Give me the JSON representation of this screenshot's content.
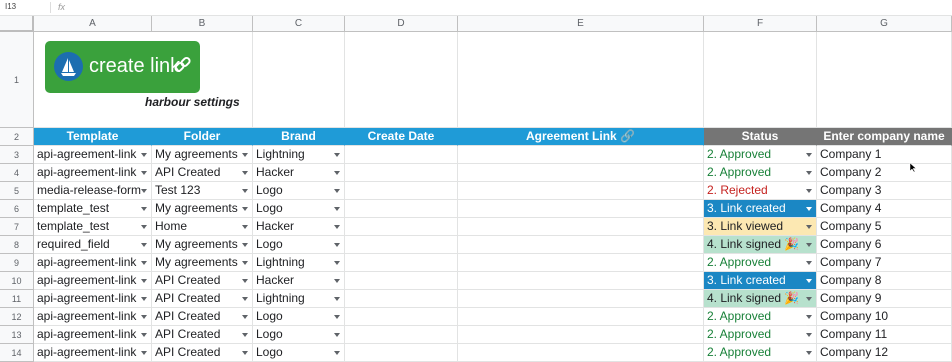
{
  "formula_bar": {
    "cell_ref": "I13",
    "fx": "fx"
  },
  "columns": [
    "A",
    "B",
    "C",
    "D",
    "E",
    "F",
    "G"
  ],
  "row_numbers": [
    "1",
    "2",
    "3",
    "4",
    "5",
    "6",
    "7",
    "8",
    "9",
    "10",
    "11",
    "12",
    "13",
    "14"
  ],
  "logo": {
    "text": "create link"
  },
  "subtitle": "harbour settings",
  "headers": {
    "template": "Template",
    "folder": "Folder",
    "brand": "Brand",
    "create_date": "Create Date",
    "agreement_link": "Agreement Link 🔗",
    "status": "Status",
    "company": "Enter company name"
  },
  "rows": [
    {
      "template": "api-agreement-link",
      "folder": "My agreements",
      "brand": "Lightning",
      "status": "2. Approved",
      "company": "Company 1"
    },
    {
      "template": "api-agreement-link",
      "folder": "API Created",
      "brand": "Hacker",
      "status": "2. Approved",
      "company": "Company 2"
    },
    {
      "template": "media-release-form",
      "folder": "Test 123",
      "brand": "Logo",
      "status": "2. Rejected",
      "company": "Company 3"
    },
    {
      "template": "template_test",
      "folder": "My agreements",
      "brand": "Logo",
      "status": "3. Link created",
      "company": "Company 4"
    },
    {
      "template": "template_test",
      "folder": "Home",
      "brand": "Hacker",
      "status": "3. Link viewed",
      "company": "Company 5"
    },
    {
      "template": "required_field",
      "folder": "My agreements",
      "brand": "Logo",
      "status": "4. Link signed 🎉",
      "company": "Company 6"
    },
    {
      "template": "api-agreement-link",
      "folder": "My agreements",
      "brand": "Lightning",
      "status": "2. Approved",
      "company": "Company 7"
    },
    {
      "template": "api-agreement-link",
      "folder": "API Created",
      "brand": "Hacker",
      "status": "3. Link created",
      "company": "Company 8"
    },
    {
      "template": "api-agreement-link",
      "folder": "API Created",
      "brand": "Lightning",
      "status": "4. Link signed 🎉",
      "company": "Company 9"
    },
    {
      "template": "api-agreement-link",
      "folder": "API Created",
      "brand": "Logo",
      "status": "2. Approved",
      "company": "Company 10"
    },
    {
      "template": "api-agreement-link",
      "folder": "API Created",
      "brand": "Logo",
      "status": "2. Approved",
      "company": "Company 11"
    },
    {
      "template": "api-agreement-link",
      "folder": "API Created",
      "brand": "Logo",
      "status": "2. Approved",
      "company": "Company 12"
    }
  ]
}
